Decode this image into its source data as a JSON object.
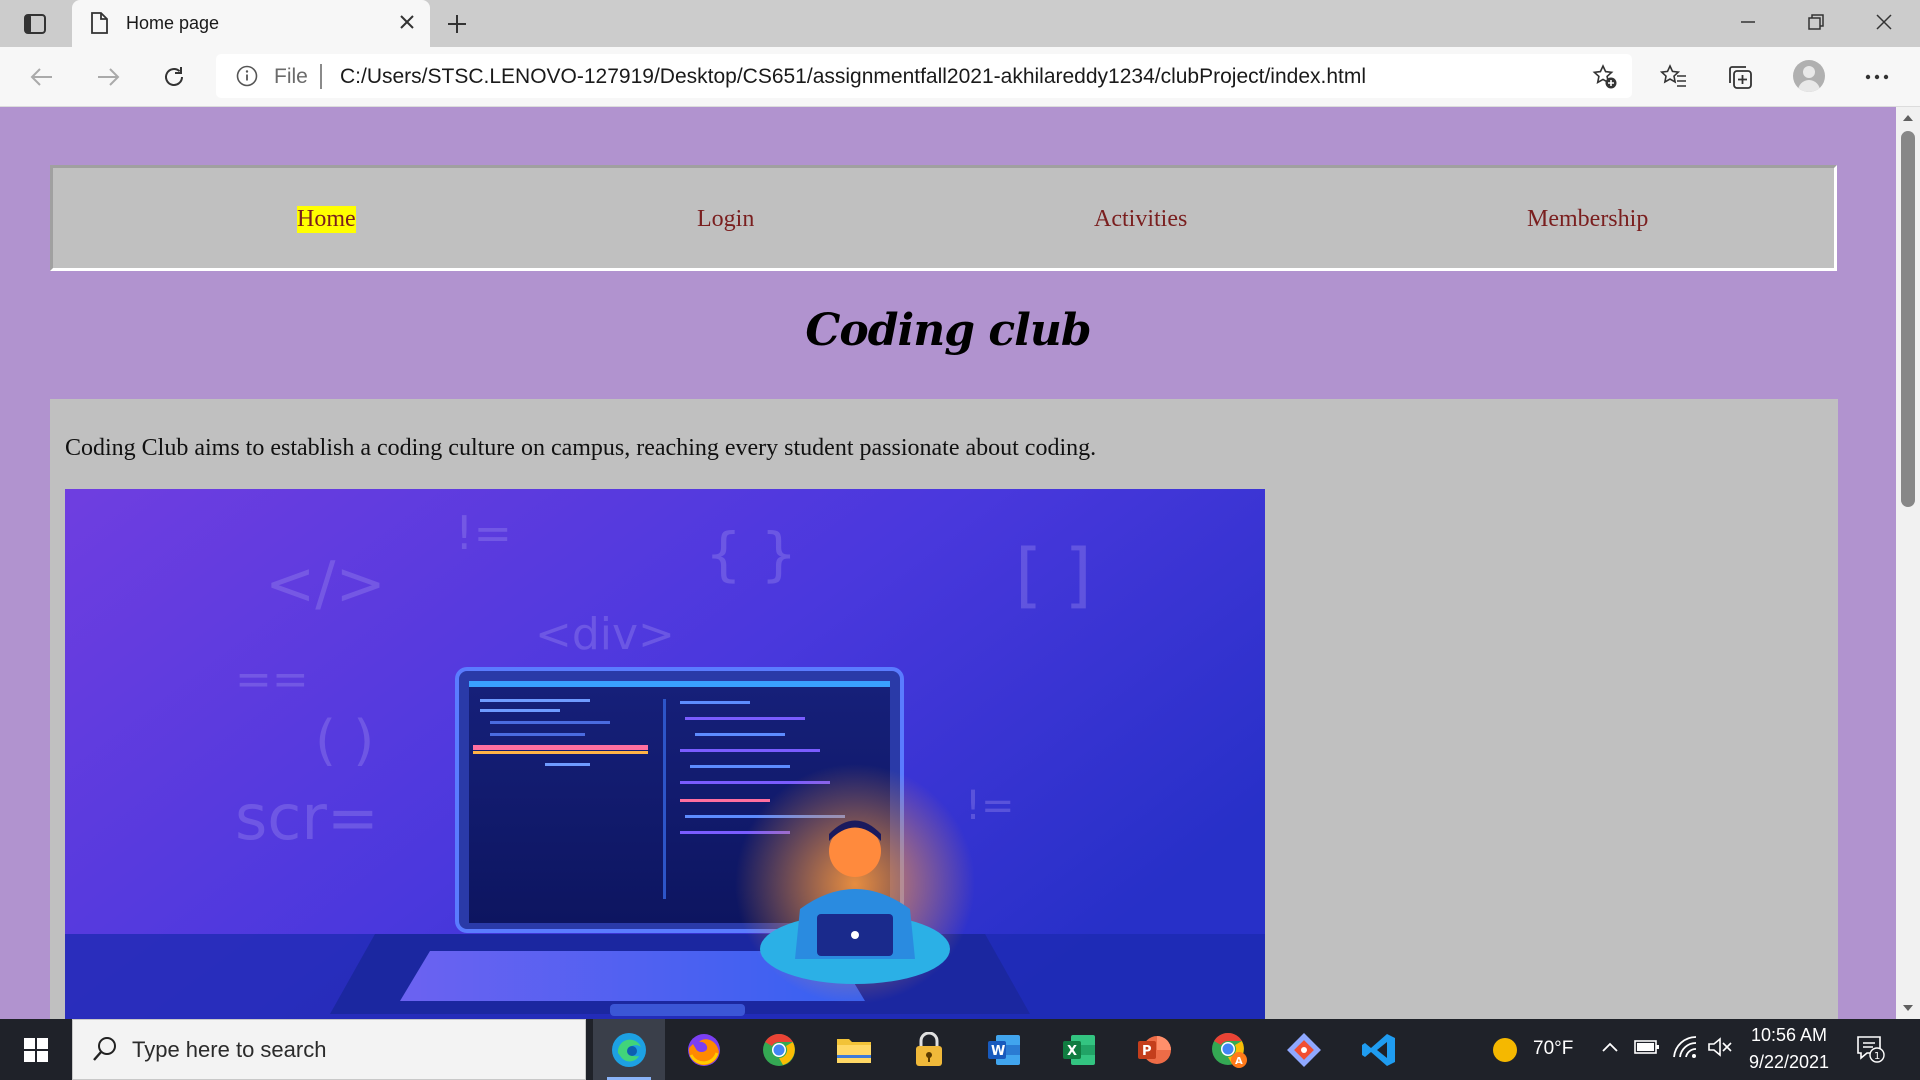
{
  "browser": {
    "tab": {
      "title": "Home page"
    },
    "address": {
      "scheme": "File",
      "url": "C:/Users/STSC.LENOVO-127919/Desktop/CS651/assignmentfall2021-akhilareddy1234/clubProject/index.html"
    }
  },
  "page": {
    "nav": {
      "items": [
        {
          "label": "Home",
          "active": true
        },
        {
          "label": "Login",
          "active": false
        },
        {
          "label": "Activities",
          "active": false
        },
        {
          "label": "Membership",
          "active": false
        }
      ]
    },
    "title": "Coding club",
    "intro": "Coding Club aims to establish a coding culture on campus, reaching every student passionate about coding.",
    "hero_glyphs": [
      "</>",
      "!=",
      "{ }",
      "<div>",
      "[ ]",
      "==",
      "( )",
      "scr=",
      "!="
    ]
  },
  "taskbar": {
    "search_placeholder": "Type here to search",
    "weather": "70°F",
    "time": "10:56 AM",
    "date": "9/22/2021",
    "notification_count": "1"
  },
  "colors": {
    "page_bg": "#b193cf",
    "panel_bg": "#c0c0c0",
    "nav_link": "#7a1f1f",
    "active_highlight": "#ffff00"
  }
}
